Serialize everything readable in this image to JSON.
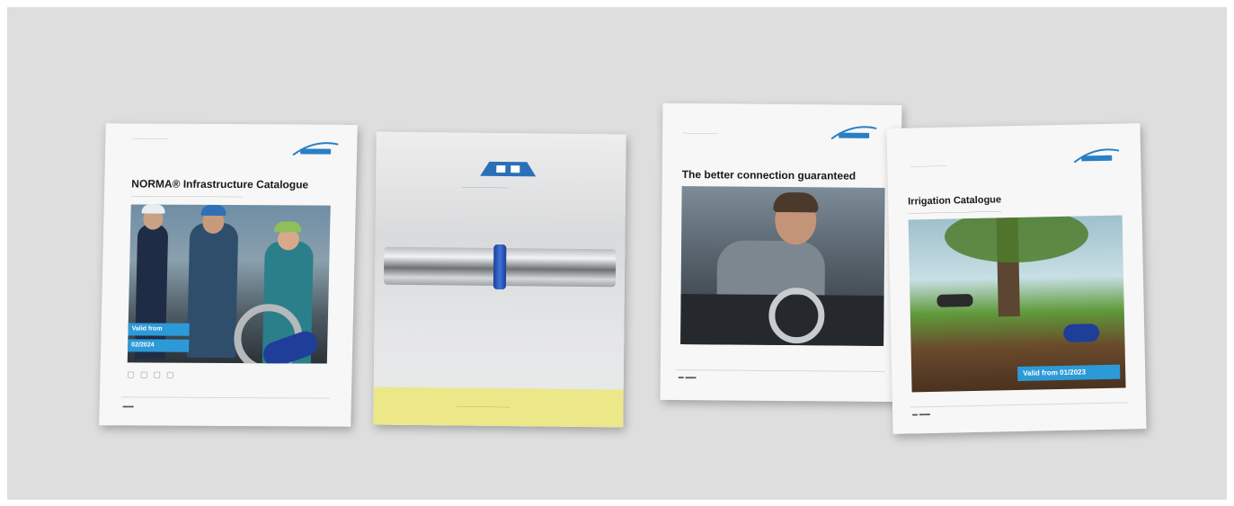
{
  "booklets": [
    {
      "title": "NORMA® Infrastructure Catalogue",
      "badge_line1": "Valid from",
      "badge_line2": "02/2024"
    },
    {
      "title": "",
      "footer_band": ""
    },
    {
      "title": "The better connection guaranteed"
    },
    {
      "title": "Irrigation Catalogue",
      "badge": "Valid from 01/2023"
    }
  ],
  "colors": {
    "background": "#dedede",
    "norma_blue": "#2a7fc4",
    "badge_blue": "#2d9ad8",
    "yellow_band": "#ece88a"
  }
}
